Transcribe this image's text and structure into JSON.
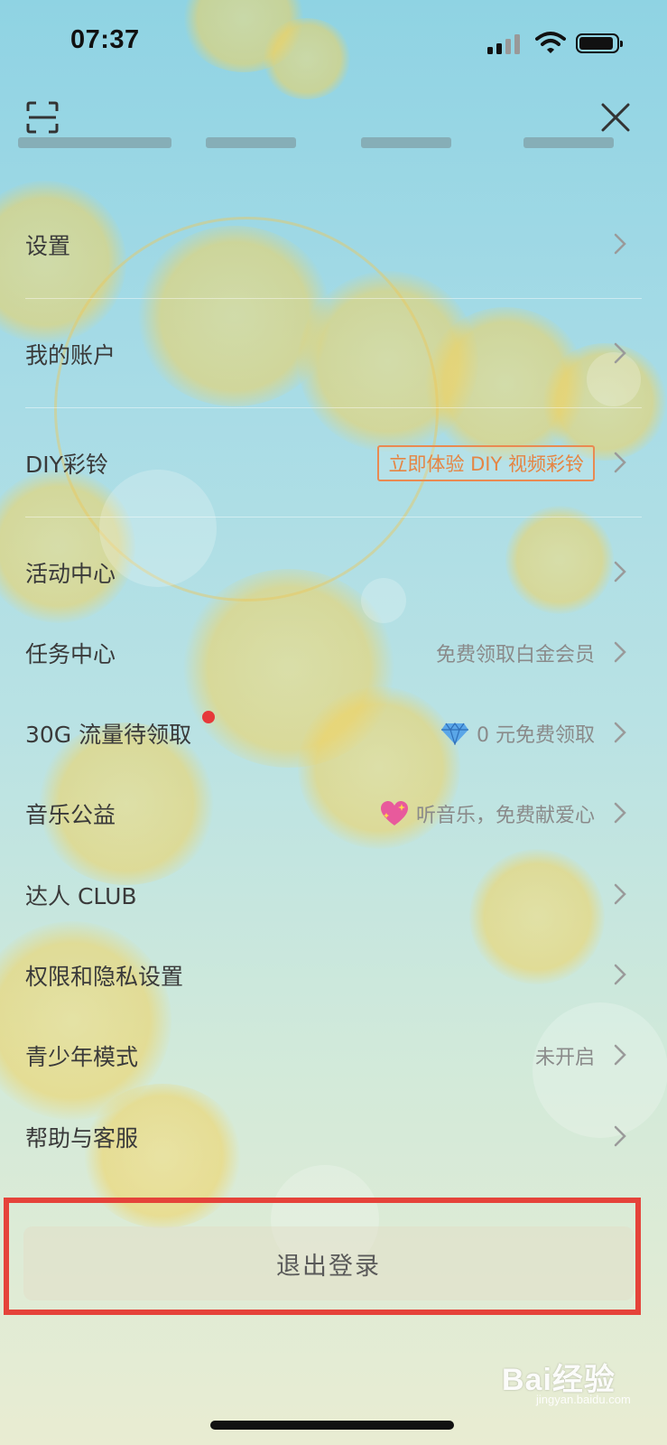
{
  "status_bar": {
    "time": "07:37"
  },
  "menu": {
    "items": [
      {
        "label": "设置",
        "extra": ""
      },
      {
        "label": "我的账户",
        "extra": ""
      },
      {
        "label": "DIY彩铃",
        "tag": "立即体验 DIY 视频彩铃"
      },
      {
        "label": "活动中心",
        "extra": ""
      },
      {
        "label": "任务中心",
        "extra": "免费领取白金会员"
      },
      {
        "label": "30G 流量待领取",
        "extra": "0 元免费领取",
        "icon": "gem-icon",
        "badge": "red-dot"
      },
      {
        "label": "音乐公益",
        "extra": "听音乐，免费献爱心",
        "icon": "sparkling-heart-icon"
      },
      {
        "label": "达人 CLUB",
        "extra": ""
      },
      {
        "label": "权限和隐私设置",
        "extra": ""
      },
      {
        "label": "青少年模式",
        "extra": "未开启"
      },
      {
        "label": "帮助与客服",
        "extra": ""
      }
    ]
  },
  "logout": {
    "label": "退出登录"
  },
  "watermark": {
    "main": "Bai经验",
    "sub": "jingyan.baidu.com"
  },
  "colors": {
    "highlight_border": "#e5433a",
    "tag_orange": "#e58543",
    "red_dot": "#e6393a"
  }
}
